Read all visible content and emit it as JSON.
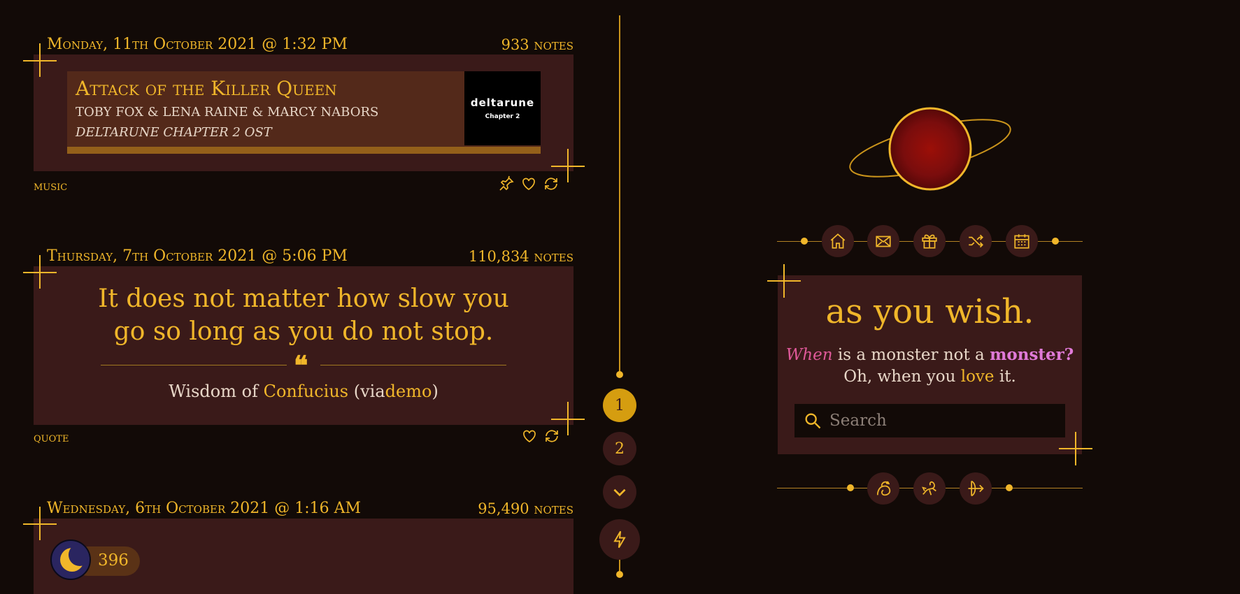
{
  "posts": [
    {
      "date": "Monday, 11th October 2021 @ 1:32 PM",
      "notes": "933 notes",
      "type": "music",
      "title": "Attack of the Killer Queen",
      "artist": "TOBY FOX & LENA RAINE & MARCY NABORS",
      "album": "DELTARUNE CHAPTER 2 OST",
      "album_art_title": "deltarune",
      "album_art_sub": "Chapter 2",
      "tag": "music"
    },
    {
      "date": "Thursday, 7th October 2021 @ 5:06 PM",
      "notes": "110,834 notes",
      "type": "quote",
      "quote": "It does not matter how slow you go so long as you do not stop.",
      "source_prefix": "Wisdom of",
      "source_author": "Confucius",
      "source_via_open": "(via",
      "source_via": "demo",
      "source_via_close": ")",
      "tag": "quote"
    },
    {
      "date": "Wednesday, 6th October 2021 @ 1:16 AM",
      "notes": "95,490 notes",
      "counter": "396"
    }
  ],
  "pagination": {
    "page1": "1",
    "page2": "2"
  },
  "sidebar": {
    "title": "as you wish.",
    "desc_when": "When",
    "desc_mid": " is a monster not a ",
    "desc_monster": "monster?",
    "desc_line2_a": "Oh, when you ",
    "desc_love": "love",
    "desc_line2_b": " it.",
    "search_placeholder": "Search"
  },
  "colors": {
    "accent": "#f0b62a",
    "background": "#120a07",
    "card": "#3a1a19",
    "pink": "#e0599a",
    "violet": "#e07ad8"
  },
  "icons": {
    "nav": [
      "home-icon",
      "mail-icon",
      "gift-icon",
      "shuffle-icon",
      "calendar-icon"
    ],
    "footer": [
      "zodiac-1-icon",
      "zodiac-2-icon",
      "sagittarius-icon"
    ]
  }
}
